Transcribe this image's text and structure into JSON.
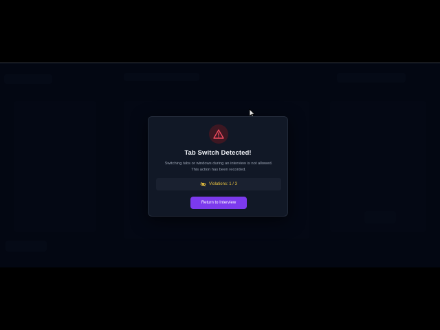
{
  "modal": {
    "icon": "warning-triangle-icon",
    "title": "Tab Switch Detected!",
    "message": "Switching tabs or windows during an interview is not allowed. This action has been recorded.",
    "violations": {
      "icon": "eye-off-icon",
      "text": "Violations: 1 / 3",
      "count": 1,
      "max": 3
    },
    "button_label": "Return to Interview"
  },
  "colors": {
    "accent": "#7c3aed",
    "warning_icon": "#ef4b5f",
    "violations_text": "#e9c23f",
    "modal_bg": "#111826",
    "page_bg": "#050a18"
  }
}
